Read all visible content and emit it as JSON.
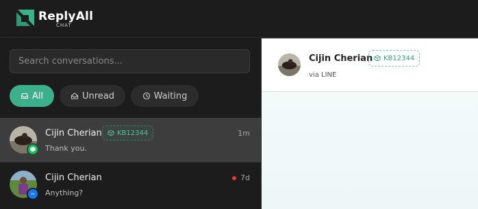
{
  "app": {
    "name": "ReplyAll",
    "subtitle": "CHAT"
  },
  "search": {
    "placeholder": "Search conversations..."
  },
  "filters": [
    {
      "label": "All",
      "active": true,
      "icon": "inbox-icon"
    },
    {
      "label": "Unread",
      "active": false,
      "icon": "envelope-icon"
    },
    {
      "label": "Waiting",
      "active": false,
      "icon": "clock-icon"
    }
  ],
  "conversations": [
    {
      "name": "Cijin Cherian",
      "tag": "KB12344",
      "preview": "Thank you.",
      "time": "1m",
      "channel": "LINE",
      "channel_icon": "line-icon",
      "selected": true,
      "unread": false
    },
    {
      "name": "Cijin Cherian",
      "preview": "Anything?",
      "time": "7d",
      "channel": "Messenger",
      "channel_icon": "messenger-icon",
      "selected": false,
      "unread": true
    }
  ],
  "chat_header": {
    "name": "Cijin Cherian",
    "tag": "KB12344",
    "via": "via LINE"
  },
  "colors": {
    "accent": "#3cb08a",
    "line_green": "#06c755",
    "messenger_blue": "#1877f2",
    "unread_red": "#e53935"
  }
}
